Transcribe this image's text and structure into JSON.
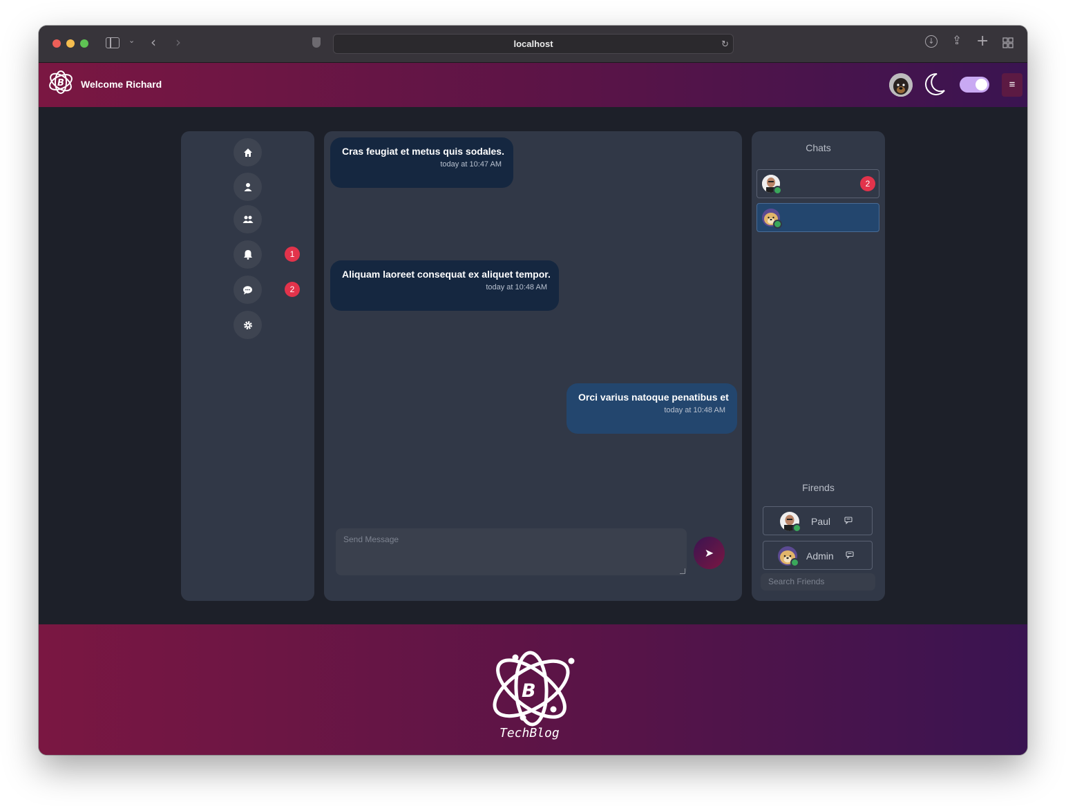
{
  "browser": {
    "url": "localhost"
  },
  "header": {
    "welcome": "Welcome Richard",
    "menu_icon": "≡",
    "theme_toggle_on": true
  },
  "sidebar": {
    "items": [
      {
        "name": "home",
        "icon": "home-icon"
      },
      {
        "name": "profile",
        "icon": "user-icon"
      },
      {
        "name": "friends",
        "icon": "users-icon"
      },
      {
        "name": "notifications",
        "icon": "bell-icon",
        "badge": "1"
      },
      {
        "name": "messages",
        "icon": "chat-bubble-icon",
        "badge": "2"
      },
      {
        "name": "settings",
        "icon": "gear-icon"
      }
    ]
  },
  "messages": [
    {
      "text": "Cras feugiat et metus quis sodales.",
      "time": "today at 10:47 AM",
      "direction": "incoming"
    },
    {
      "text": "Aliquam laoreet consequat ex aliquet tempor.",
      "time": "today at 10:48 AM",
      "direction": "incoming"
    },
    {
      "text": "Orci varius natoque penatibus et",
      "time": "today at 10:48 AM",
      "direction": "outgoing"
    }
  ],
  "composer": {
    "placeholder": "Send Message",
    "send_icon": "➤"
  },
  "chats": {
    "title": "Chats",
    "items": [
      {
        "avatar": "bald-man-avatar",
        "badge": "2",
        "active": false
      },
      {
        "avatar": "doge-avatar",
        "active": true
      }
    ]
  },
  "friends": {
    "title": "Firends",
    "items": [
      {
        "name": "Paul",
        "avatar": "bald-man-avatar",
        "icon": "message-icon"
      },
      {
        "name": "Admin",
        "avatar": "doge-avatar",
        "icon": "message-icon"
      }
    ],
    "search_placeholder": "Search Friends"
  },
  "footer": {
    "brand_letter": "B",
    "brand_name": "TechBlog"
  },
  "colors": {
    "brand_gradient_start": "#7a1742",
    "brand_gradient_end": "#3a1451",
    "badge": "#e2334b",
    "incoming_bubble": "#152740",
    "outgoing_bubble": "#23466e",
    "panel": "#313847",
    "background": "#1d2029",
    "online": "#3aa85b"
  }
}
